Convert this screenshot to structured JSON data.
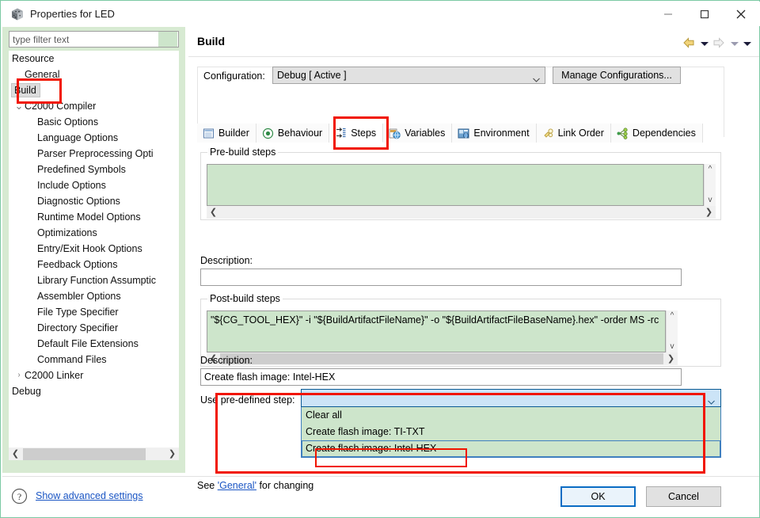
{
  "window": {
    "title": "Properties for LED",
    "icon": "ccs-cube-icon",
    "controls": {
      "minimize": "minimize-icon",
      "maximize": "maximize-icon",
      "close": "close-icon"
    }
  },
  "sidebar": {
    "filter": {
      "placeholder": "type filter text",
      "value": ""
    },
    "items": [
      {
        "label": "Resource",
        "indent": 0,
        "twisty": "collapsed",
        "selected": false
      },
      {
        "label": "General",
        "indent": 1,
        "twisty": "none",
        "selected": false
      },
      {
        "label": "Build",
        "indent": 0,
        "twisty": "expanded",
        "selected": true
      },
      {
        "label": "C2000 Compiler",
        "indent": 1,
        "twisty": "expanded",
        "selected": false
      },
      {
        "label": "Basic Options",
        "indent": 2,
        "twisty": "none",
        "selected": false
      },
      {
        "label": "Language Options",
        "indent": 2,
        "twisty": "none",
        "selected": false
      },
      {
        "label": "Parser Preprocessing Opti",
        "indent": 2,
        "twisty": "none",
        "selected": false
      },
      {
        "label": "Predefined Symbols",
        "indent": 2,
        "twisty": "none",
        "selected": false
      },
      {
        "label": "Include Options",
        "indent": 2,
        "twisty": "none",
        "selected": false
      },
      {
        "label": "Diagnostic Options",
        "indent": 2,
        "twisty": "none",
        "selected": false
      },
      {
        "label": "Runtime Model Options",
        "indent": 2,
        "twisty": "none",
        "selected": false
      },
      {
        "label": "Optimizations",
        "indent": 2,
        "twisty": "none",
        "selected": false
      },
      {
        "label": "Entry/Exit Hook Options",
        "indent": 2,
        "twisty": "none",
        "selected": false
      },
      {
        "label": "Feedback Options",
        "indent": 2,
        "twisty": "none",
        "selected": false
      },
      {
        "label": "Library Function Assumptic",
        "indent": 2,
        "twisty": "none",
        "selected": false
      },
      {
        "label": "Assembler Options",
        "indent": 2,
        "twisty": "none",
        "selected": false
      },
      {
        "label": "File Type Specifier",
        "indent": 2,
        "twisty": "none",
        "selected": false
      },
      {
        "label": "Directory Specifier",
        "indent": 2,
        "twisty": "none",
        "selected": false
      },
      {
        "label": "Default File Extensions",
        "indent": 2,
        "twisty": "none",
        "selected": false
      },
      {
        "label": "Command Files",
        "indent": 2,
        "twisty": "none",
        "selected": false
      },
      {
        "label": "C2000 Linker",
        "indent": 1,
        "twisty": "collapsed",
        "selected": false
      },
      {
        "label": "Debug",
        "indent": 0,
        "twisty": "none",
        "selected": false
      }
    ]
  },
  "page": {
    "title": "Build",
    "nav": {
      "back": "back-arrow-icon",
      "back_menu": "back-dropdown-caret",
      "forward": "forward-arrow-icon",
      "forward_menu": "forward-dropdown-caret",
      "view_menu": "view-menu-caret"
    },
    "configuration": {
      "label": "Configuration:",
      "value": "Debug  [ Active ]",
      "manage_button": "Manage Configurations..."
    },
    "tabs": [
      {
        "label": "Builder",
        "icon": "builder-icon",
        "active": false
      },
      {
        "label": "Behaviour",
        "icon": "behaviour-icon",
        "active": false
      },
      {
        "label": "Steps",
        "icon": "steps-icon",
        "active": true
      },
      {
        "label": "Variables",
        "icon": "variables-icon",
        "active": false
      },
      {
        "label": "Environment",
        "icon": "environment-icon",
        "active": false
      },
      {
        "label": "Link Order",
        "icon": "link-order-icon",
        "active": false
      },
      {
        "label": "Dependencies",
        "icon": "dependencies-icon",
        "active": false
      }
    ],
    "prebuild": {
      "group_title": "Pre-build steps",
      "command": "",
      "description_label": "Description:",
      "description": ""
    },
    "postbuild": {
      "group_title": "Post-build steps",
      "command": "\"${CG_TOOL_HEX}\" -i \"${BuildArtifactFileName}\" -o \"${BuildArtifactFileBaseName}.hex\" -order MS -rc",
      "description_label": "Description:",
      "description": "Create flash image: Intel-HEX"
    },
    "predefined": {
      "label": "Use pre-defined step:",
      "value": "",
      "options": [
        "Clear all",
        "Create flash image: TI-TXT",
        "Create flash image: Intel-HEX"
      ],
      "highlighted_option": "Create flash image: Intel-HEX"
    },
    "footer_note": {
      "prefix": "See ",
      "link": "'General'",
      "suffix": " for changing"
    }
  },
  "bottom": {
    "help_icon": "help-question-icon",
    "advanced_link": "Show advanced settings",
    "ok_button": "OK",
    "cancel_button": "Cancel"
  },
  "colors": {
    "frame_green": "#7cc9a4",
    "panel_green": "#d7ead2",
    "field_green": "#cde5cb",
    "combo_blue": "#cce4f7",
    "annotation_red": "#f11500",
    "link_blue": "#1a55c4",
    "focus_blue": "#0a6cc4"
  }
}
